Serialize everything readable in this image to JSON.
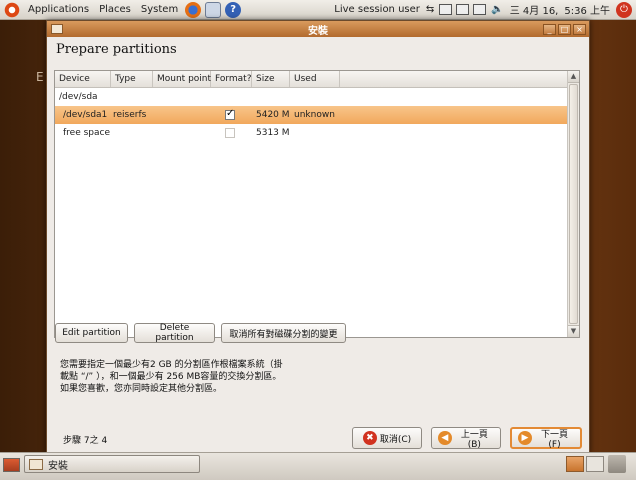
{
  "top_panel": {
    "menus": [
      "Applications",
      "Places",
      "System"
    ],
    "user": "Live session user",
    "date": "三 4月 16,",
    "time": "5:36 上午"
  },
  "background_text": "E",
  "window": {
    "title": "安裝",
    "heading": "Prepare partitions",
    "columns": [
      "Device",
      "Type",
      "Mount point",
      "Format?",
      "Size",
      "Used"
    ],
    "rows": [
      {
        "device": "/dev/sda",
        "type": "",
        "mount": "",
        "format": null,
        "size": "",
        "used": "",
        "selected": false
      },
      {
        "device": "/dev/sda1",
        "type": "reiserfs",
        "mount": "",
        "format": true,
        "size": "5420 MB",
        "used": "unknown",
        "selected": true
      },
      {
        "device": "free space",
        "type": "",
        "mount": "",
        "format": false,
        "size": "5313 MB",
        "used": "",
        "selected": false
      }
    ],
    "buttons": {
      "edit": "Edit partition",
      "delete": "Delete partition",
      "undo": "取消所有對磁碟分割的變更"
    },
    "description": [
      "您需要指定一個最少有2 GB 的分割區作根檔案系統（掛",
      "載點 “/” ），和一個最少有 256 MB容量的交換分割區。",
      "如果您喜歡，您亦同時設定其他分割區。"
    ],
    "step": "步驟 7之 4",
    "nav": {
      "cancel": "取消(C)",
      "back": "上一頁(B)",
      "forward": "下一頁(F)"
    }
  },
  "taskbar": {
    "task": "安裝"
  }
}
